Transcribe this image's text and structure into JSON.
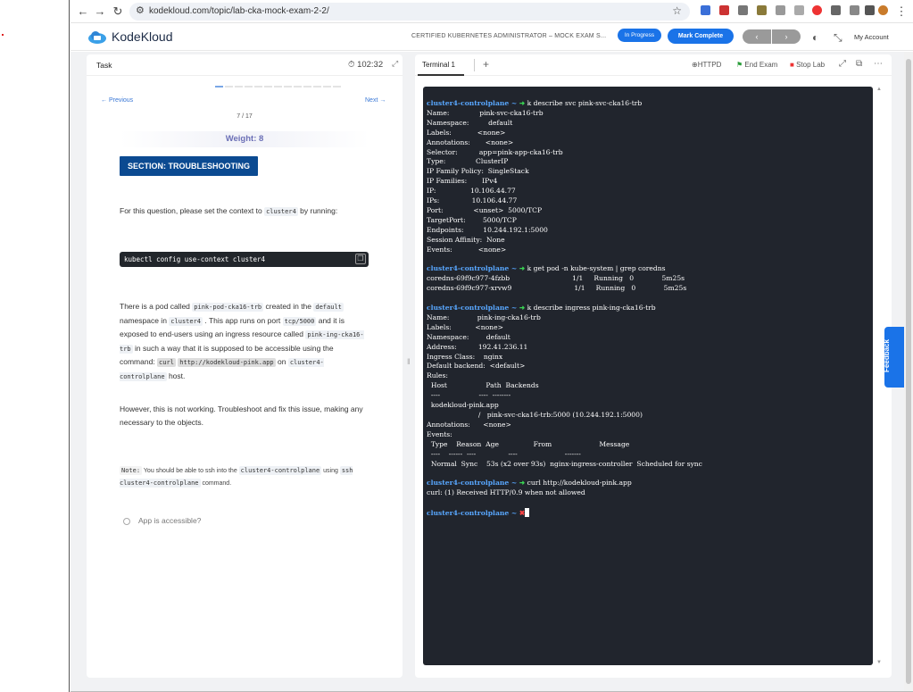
{
  "browser": {
    "url": "kodekloud.com/topic/lab-cka-mock-exam-2-2/",
    "nav": {
      "back": "←",
      "forward": "→",
      "reload": "↻",
      "tune": "⚙",
      "star": "☆",
      "menu": "⋮"
    }
  },
  "header": {
    "logo_text": "KodeKloud",
    "exam_title": "CERTIFIED KUBERNETES ADMINISTRATOR – MOCK EXAM S...",
    "in_progress_label": "In Progress",
    "mark_complete_label": "Mark Complete",
    "prev_arrow": "‹",
    "next_arrow": "›",
    "my_account_label": "My Account"
  },
  "task": {
    "tab_label": "Task",
    "timer": "102:32",
    "previous_label": "← Previous",
    "next_label": "Next →",
    "counter": "7 / 17",
    "weight": "Weight: 8",
    "section": "SECTION: TROUBLESHOOTING",
    "p1_a": "For this question, please set the context to ",
    "p1_code": "cluster4",
    "p1_b": " by running:",
    "command": "kubectl config use-context cluster4",
    "p2_a": "There is a pod called ",
    "p2_code1": "pink-pod-cka16-trb",
    "p2_b": " created in the ",
    "p2_code2": "default",
    "p2_c": " namespace in ",
    "p2_code3": "cluster4",
    "p2_d": " . This app runs on port ",
    "p2_code4": "tcp/5000",
    "p2_e": " and it is exposed to end-users using an ingress resource called ",
    "p2_code5": "pink-ing-cka16-trb",
    "p2_f": " in such a way that it is supposed to be accessible using the command: ",
    "p2_code6a": "curl",
    "p2_code6b": "http://kodekloud-pink.app",
    "p2_g": " on ",
    "p2_code7": "cluster4-controlplane",
    "p2_h": " host.",
    "p3": "However, this is not working. Troubleshoot and fix this issue, making any necessary to the objects.",
    "note_label": "Note:",
    "note_a": " You should be able to ssh into the ",
    "note_code1": "cluster4-controlplane",
    "note_b": " using ",
    "note_code2": "ssh cluster4-controlplane",
    "note_c": " command.",
    "check_label": "App is accessible?"
  },
  "terminal_bar": {
    "tab_label": "Terminal 1",
    "add": "+",
    "httpd_label": "HTTPD",
    "end_exam_label": "End Exam",
    "stop_lab_label": "Stop Lab"
  },
  "terminal": {
    "prompt": "cluster4-controlplane ~ ",
    "arrow": "➜",
    "cross": "✖",
    "cmd1": " k describe svc pink-svc-cka16-trb",
    "out1": "Name:              pink-svc-cka16-trb\nNamespace:         default\nLabels:            <none>\nAnnotations:       <none>\nSelector:          app=pink-app-cka16-trb\nType:              ClusterIP\nIP Family Policy:  SingleStack\nIP Families:       IPv4\nIP:                10.106.44.77\nIPs:               10.106.44.77\nPort:              <unset>  5000/TCP\nTargetPort:        5000/TCP\nEndpoints:         10.244.192.1:5000\nSession Affinity:  None\nEvents:            <none>",
    "cmd2": " k get pod -n kube-system | grep coredns",
    "out2": "coredns-69f9c977-4fzbb                             1/1     Running   0             5m25s\ncoredns-69f9c977-xrvw9                             1/1     Running   0             5m25s",
    "cmd3": " k describe ingress pink-ing-cka16-trb",
    "out3": "Name:             pink-ing-cka16-trb\nLabels:           <none>\nNamespace:        default\nAddress:          192.41.236.11\nIngress Class:    nginx\nDefault backend:  <default>\nRules:\n  Host                  Path  Backends\n  ----                  ----  --------\n  kodekloud-pink.app\n                        /   pink-svc-cka16-trb:5000 (10.244.192.1:5000)\nAnnotations:      <none>\nEvents:\n  Type    Reason  Age                From                      Message\n  ----    ------  ----               ----                      -------\n  Normal  Sync    53s (x2 over 93s)  nginx-ingress-controller  Scheduled for sync",
    "cmd4": " curl http://kodekloud-pink.app",
    "out4": "curl: (1) Received HTTP/0.9 when not allowed"
  },
  "feedback_label": "Feedback",
  "colors": {
    "accent": "#1a73e8",
    "section_bg": "#0b4a91",
    "terminal_bg": "#21252d",
    "prompt": "#58a7ff",
    "arrow_ok": "#39d353",
    "arrow_err": "#ff4444"
  }
}
